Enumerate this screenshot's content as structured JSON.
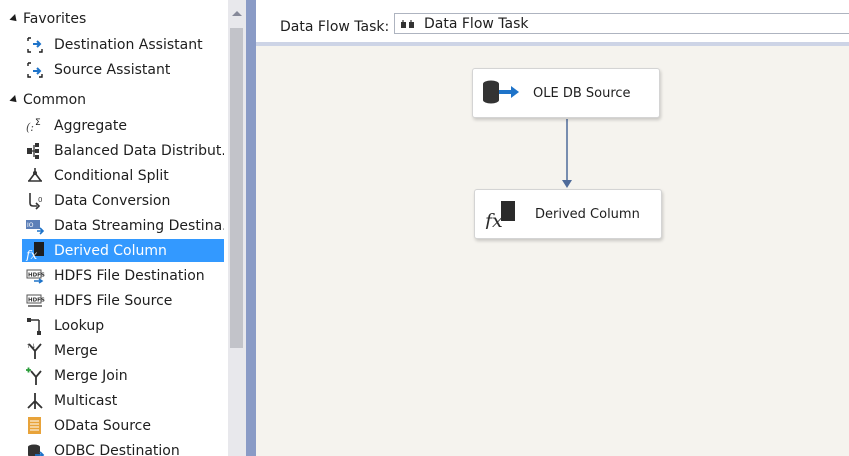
{
  "toolbox": {
    "groups": [
      {
        "label": "Favorites",
        "items": [
          {
            "label": "Destination Assistant",
            "icon": "destination-assistant-icon"
          },
          {
            "label": "Source Assistant",
            "icon": "source-assistant-icon"
          }
        ]
      },
      {
        "label": "Common",
        "items": [
          {
            "label": "Aggregate",
            "icon": "aggregate-icon"
          },
          {
            "label": "Balanced Data Distribut...",
            "icon": "balanced-data-distributor-icon"
          },
          {
            "label": "Conditional Split",
            "icon": "conditional-split-icon"
          },
          {
            "label": "Data Conversion",
            "icon": "data-conversion-icon"
          },
          {
            "label": "Data Streaming Destina...",
            "icon": "data-streaming-destination-icon"
          },
          {
            "label": "Derived Column",
            "icon": "derived-column-icon",
            "selected": true
          },
          {
            "label": "HDFS File Destination",
            "icon": "hdfs-file-destination-icon"
          },
          {
            "label": "HDFS File Source",
            "icon": "hdfs-file-source-icon"
          },
          {
            "label": "Lookup",
            "icon": "lookup-icon"
          },
          {
            "label": "Merge",
            "icon": "merge-icon"
          },
          {
            "label": "Merge Join",
            "icon": "merge-join-icon"
          },
          {
            "label": "Multicast",
            "icon": "multicast-icon"
          },
          {
            "label": "OData Source",
            "icon": "odata-source-icon"
          },
          {
            "label": "ODBC Destination",
            "icon": "odbc-destination-icon"
          }
        ]
      }
    ]
  },
  "task_bar": {
    "label": "Data Flow Task:",
    "selected_task": "Data Flow Task",
    "icon": "data-flow-task-icon"
  },
  "components": [
    {
      "label": "OLE DB Source",
      "icon": "ole-db-source-icon"
    },
    {
      "label": "Derived Column",
      "icon": "derived-column-icon"
    }
  ],
  "colors": {
    "selection": "#3399ff",
    "canvas": "#f5f3ee",
    "divider": "#8a9bc6",
    "path": "#4f6b9a"
  }
}
